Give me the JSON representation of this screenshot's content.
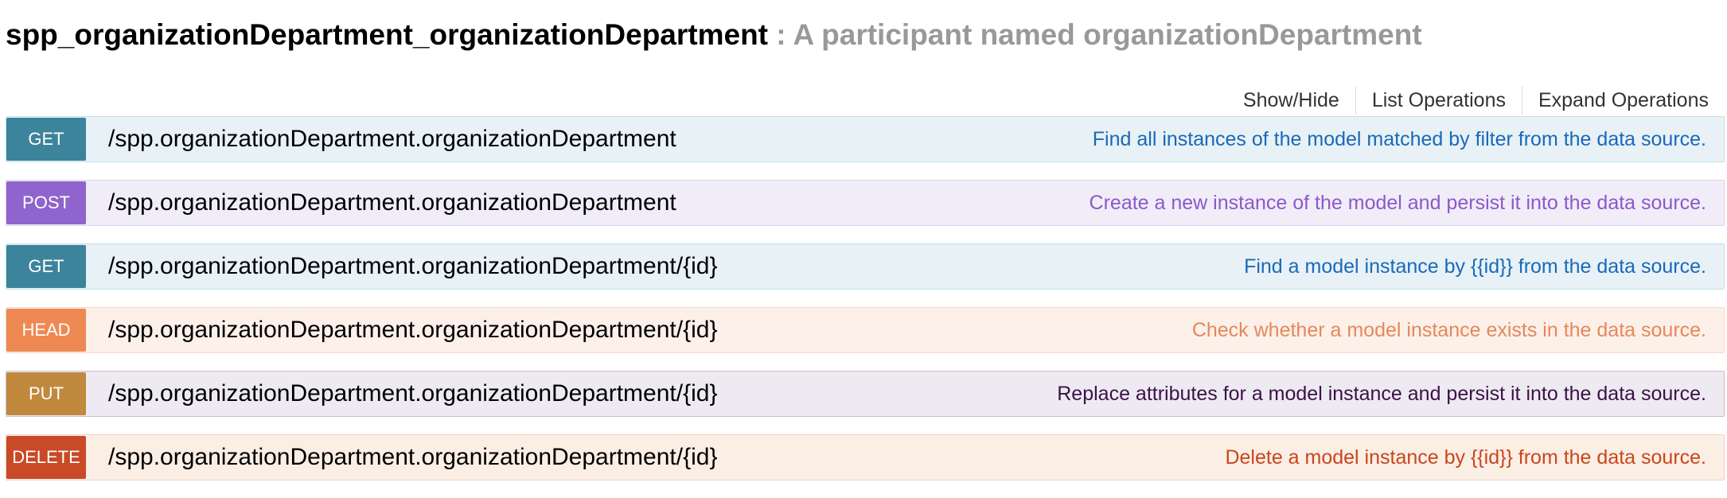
{
  "resource": {
    "name": "spp_organizationDepartment_organizationDepartment",
    "description": ": A participant named organizationDepartment"
  },
  "toolbar": {
    "show_hide": "Show/Hide",
    "list_operations": "List Operations",
    "expand_operations": "Expand Operations"
  },
  "endpoints": [
    {
      "method": "GET",
      "path": "/spp.organizationDepartment.organizationDepartment",
      "description": "Find all instances of the model matched by filter from the data source.",
      "badge_color": "#3c849b",
      "row_bg": "#e7f1f6",
      "row_border": "#c5e1ea",
      "text_color": "#1a69b8"
    },
    {
      "method": "POST",
      "path": "/spp.organizationDepartment.organizationDepartment",
      "description": "Create a new instance of the model and persist it into the data source.",
      "badge_color": "#8f64cc",
      "row_bg": "#f0edf9",
      "row_border": "#dcd0f0",
      "text_color": "#8e58c8"
    },
    {
      "method": "GET",
      "path": "/spp.organizationDepartment.organizationDepartment/{id}",
      "description": "Find a model instance by {{id}} from the data source.",
      "badge_color": "#3c849b",
      "row_bg": "#e7f1f6",
      "row_border": "#c5e1ea",
      "text_color": "#1a69b8"
    },
    {
      "method": "HEAD",
      "path": "/spp.organizationDepartment.organizationDepartment/{id}",
      "description": "Check whether a model instance exists in the data source.",
      "badge_color": "#ee8953",
      "row_bg": "#fcf0e9",
      "row_border": "#f5d8c7",
      "text_color": "#e6885c"
    },
    {
      "method": "PUT",
      "path": "/spp.organizationDepartment.organizationDepartment/{id}",
      "description": "Replace attributes for a model instance and persist it into the data source.",
      "badge_color": "#c0893e",
      "row_bg": "#eeeaf2",
      "row_border": "#c6c0cc",
      "text_color": "#3d1148"
    },
    {
      "method": "DELETE",
      "path": "/spp.organizationDepartment.organizationDepartment/{id}",
      "description": "Delete a model instance by {{id}} from the data source.",
      "badge_color": "#c84a26",
      "row_bg": "#fbeee5",
      "row_border": "#f2d0c0",
      "text_color": "#c9461c"
    }
  ]
}
